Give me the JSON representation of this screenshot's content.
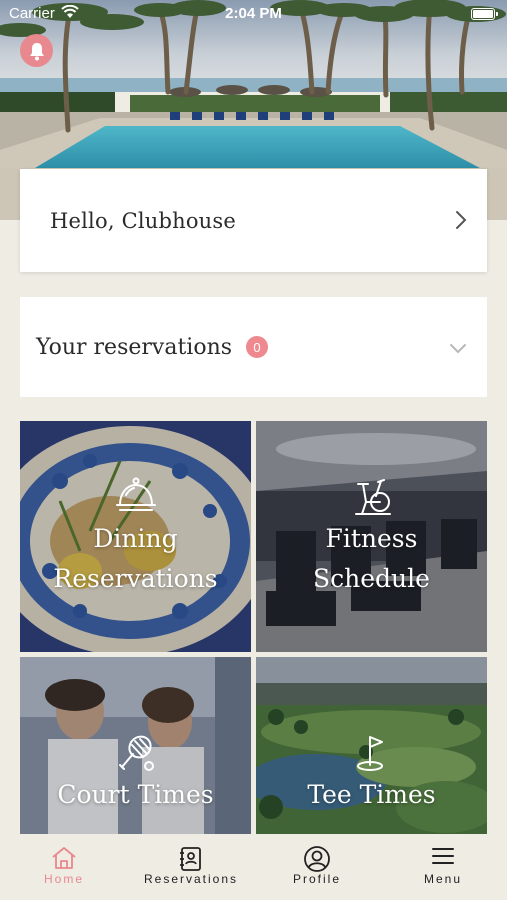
{
  "status_bar": {
    "carrier": "Carrier",
    "time": "2:04 PM",
    "wifi_icon": "wifi-icon",
    "battery_icon": "battery-icon"
  },
  "hero": {
    "image": "resort-pool-with-palm-trees",
    "notification_icon": "bell-icon"
  },
  "greeting": {
    "text": "Hello, Clubhouse",
    "icon": "chevron-right-icon"
  },
  "reservations": {
    "title": "Your reservations",
    "count": "0",
    "icon": "chevron-down-icon"
  },
  "tiles": [
    {
      "line1": "Dining",
      "line2": "Reservations",
      "icon": "cloche-icon"
    },
    {
      "line1": "Fitness",
      "line2": "Schedule",
      "icon": "exercise-bike-icon"
    },
    {
      "label": "Court Times",
      "icon": "tennis-racket-icon"
    },
    {
      "label": "Tee Times",
      "icon": "golf-flag-icon"
    }
  ],
  "tabbar": {
    "items": [
      {
        "label": "Home",
        "icon": "home-icon",
        "active": true
      },
      {
        "label": "Reservations",
        "icon": "reservations-book-icon",
        "active": false
      },
      {
        "label": "Profile",
        "icon": "profile-icon",
        "active": false
      },
      {
        "label": "Menu",
        "icon": "hamburger-menu-icon",
        "active": false
      }
    ]
  },
  "colors": {
    "accent": "#e8888f",
    "background": "#efece4",
    "card": "#ffffff",
    "text": "#2b2b2b"
  }
}
